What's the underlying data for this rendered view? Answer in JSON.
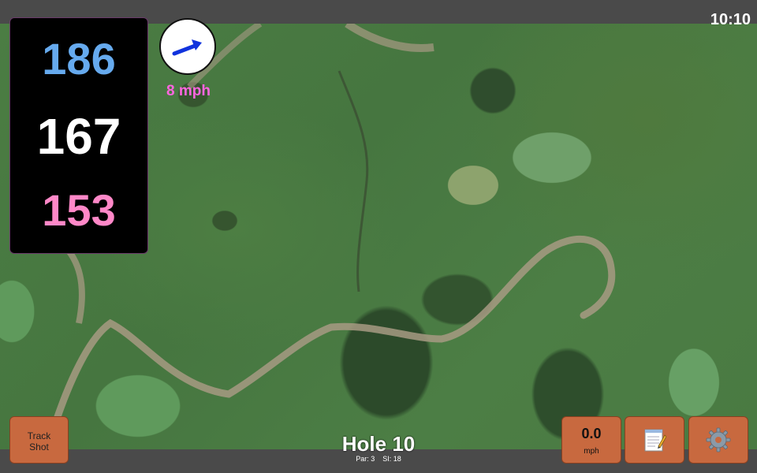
{
  "status": {
    "time": "10:10"
  },
  "yardages": {
    "back": "186",
    "middle": "167",
    "front": "153"
  },
  "wind": {
    "speed": "8 mph",
    "icon": "wind-arrow-icon"
  },
  "hole": {
    "title": "Hole 10",
    "par": "Par: 3",
    "stroke_index": "SI: 18"
  },
  "buttons": {
    "track_shot": {
      "line1": "Track",
      "line2": "Shot"
    },
    "speed": {
      "value": "0.0",
      "unit": "mph"
    },
    "notes": {
      "icon": "notepad-icon"
    },
    "settings": {
      "icon": "gear-icon"
    }
  },
  "colors": {
    "back_yardage": "#66aaee",
    "middle_yardage": "#ffffff",
    "front_yardage": "#ff88c8",
    "wind_text": "#ff66e0",
    "button": "#c8693f"
  }
}
